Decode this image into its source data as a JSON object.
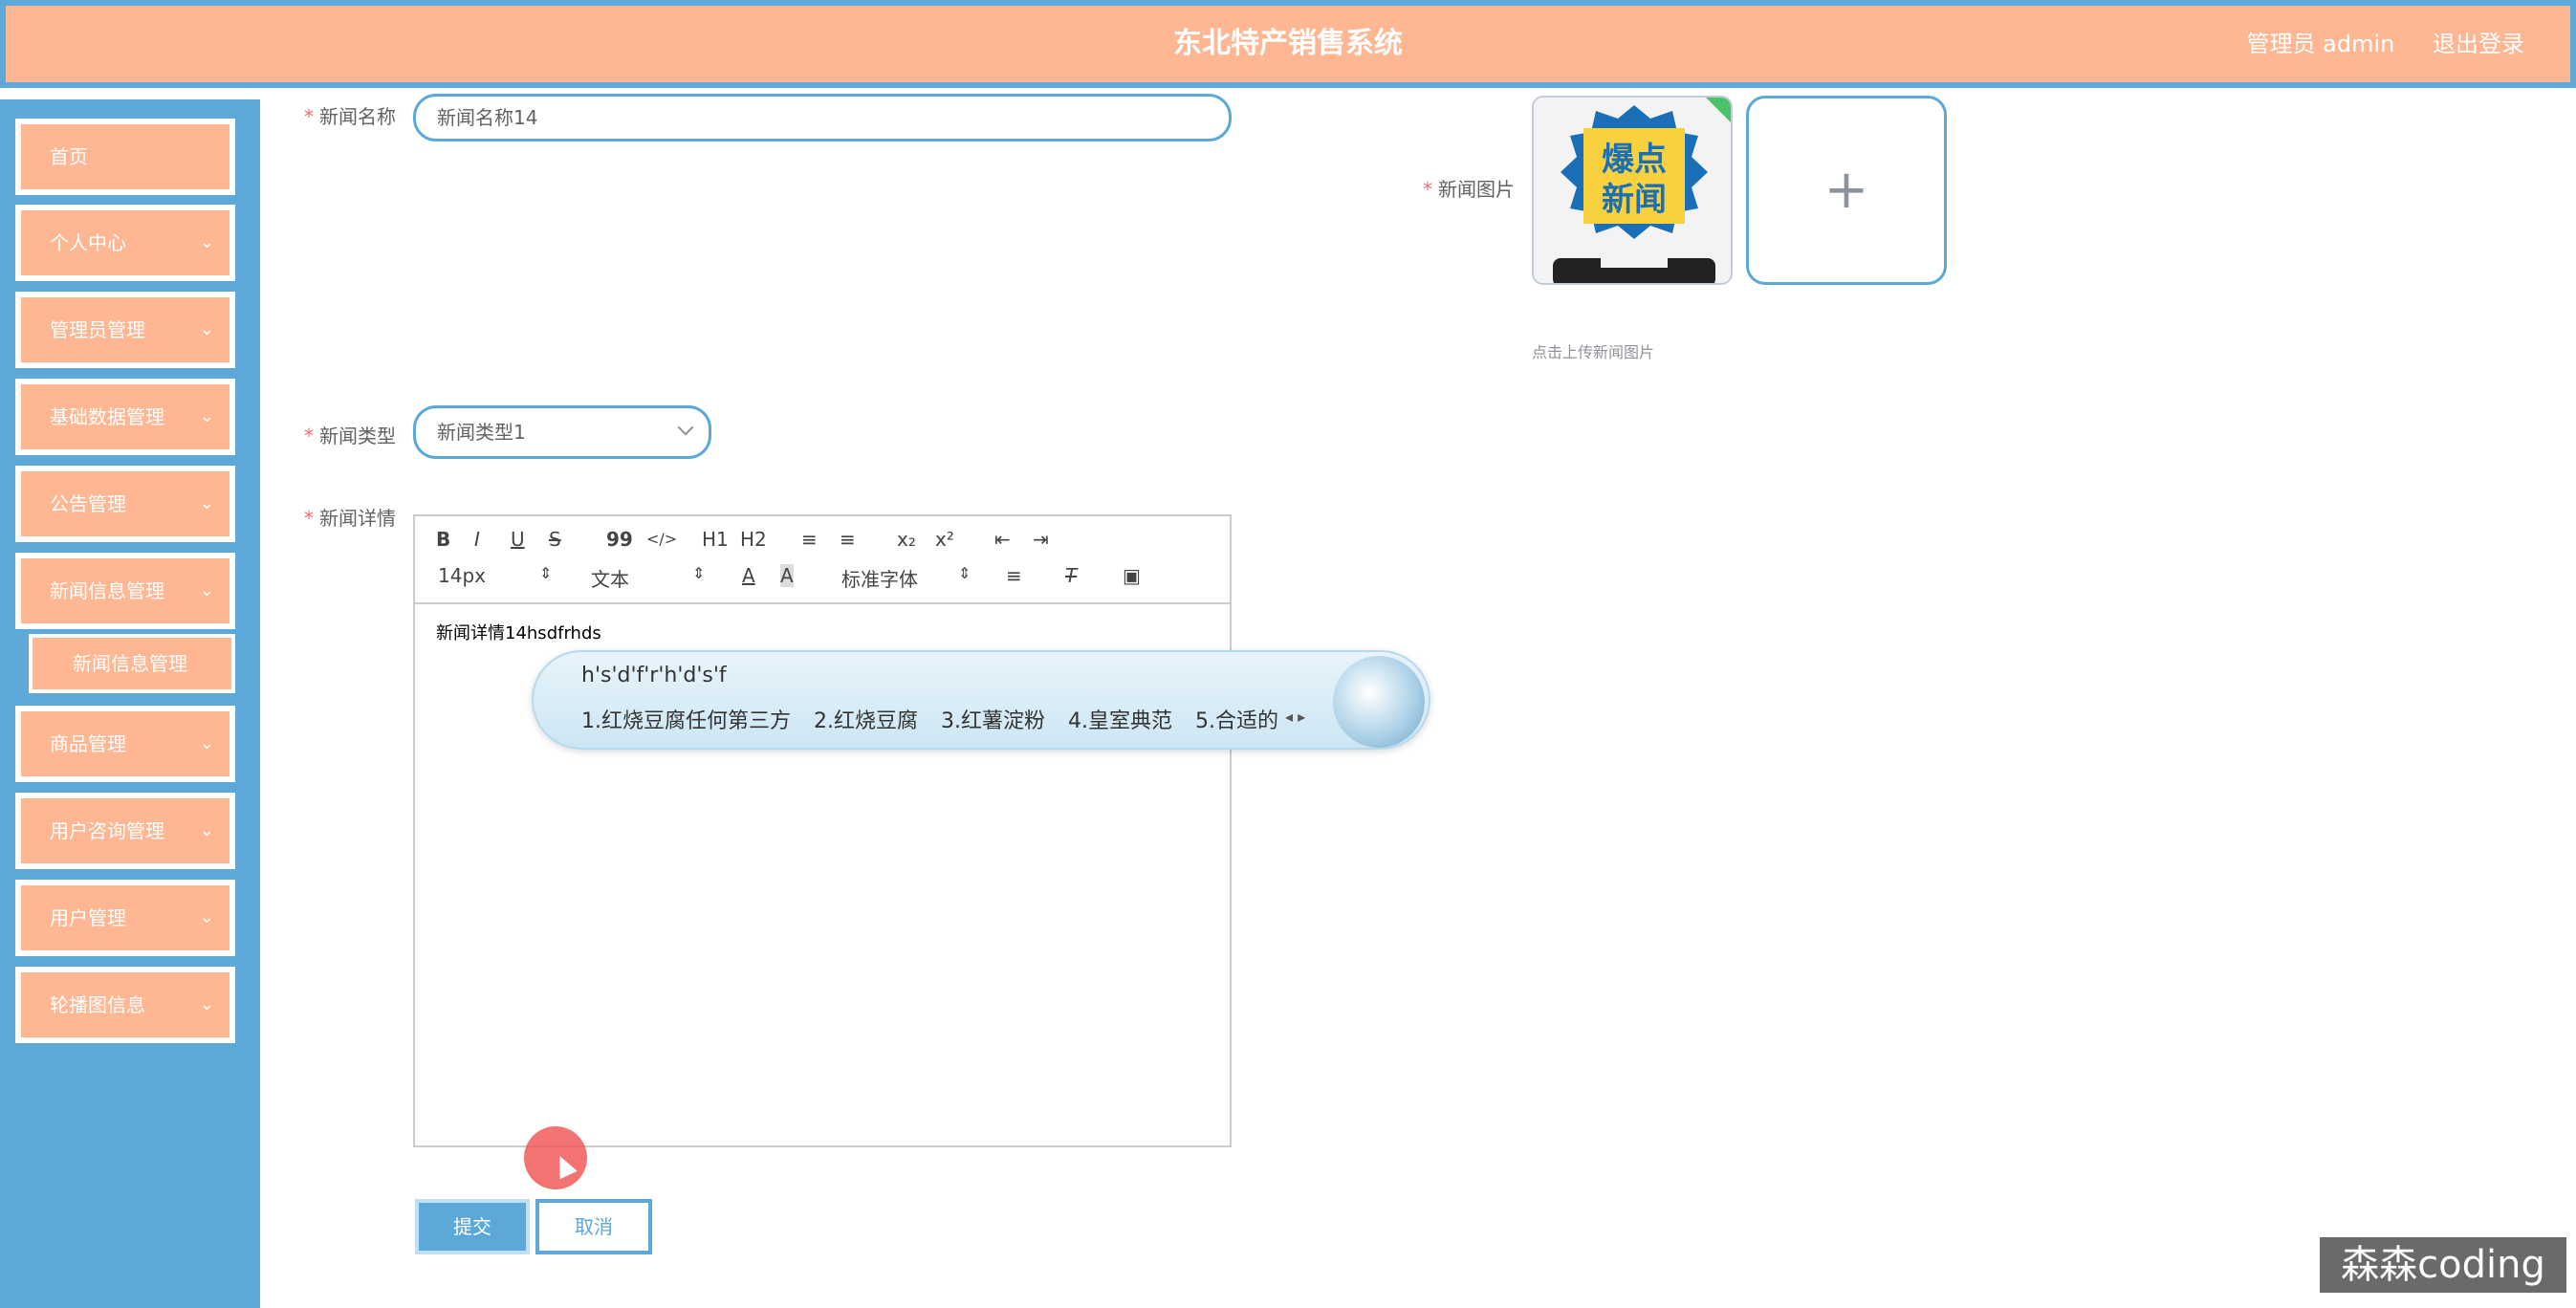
{
  "header": {
    "title": "东北特产销售系统",
    "user": "管理员 admin",
    "logout": "退出登录"
  },
  "sidebar": {
    "items": [
      {
        "label": "首页",
        "chevron": false
      },
      {
        "label": "个人中心",
        "chevron": true
      },
      {
        "label": "管理员管理",
        "chevron": true
      },
      {
        "label": "基础数据管理",
        "chevron": true
      },
      {
        "label": "公告管理",
        "chevron": true
      },
      {
        "label": "新闻信息管理",
        "chevron": true
      },
      {
        "label": "商品管理",
        "chevron": true
      },
      {
        "label": "用户咨询管理",
        "chevron": true
      },
      {
        "label": "用户管理",
        "chevron": true
      },
      {
        "label": "轮播图信息",
        "chevron": true
      }
    ],
    "sub_item": "新闻信息管理"
  },
  "form": {
    "name_label": "新闻名称",
    "name_value": "新闻名称14",
    "image_label": "新闻图片",
    "image_text_line1": "爆点",
    "image_text_line2": "新闻",
    "upload_plus": "+",
    "upload_tip": "点击上传新闻图片",
    "type_label": "新闻类型",
    "type_value": "新闻类型1",
    "detail_label": "新闻详情",
    "required_mark": "*"
  },
  "editor": {
    "toolbar": {
      "bold": "B",
      "italic": "I",
      "underline": "U",
      "strike": "S",
      "quote": "99",
      "code": "</>",
      "h1": "H1",
      "h2": "H2",
      "ol": "≡",
      "ul": "≡",
      "sub": "x₂",
      "sup": "x²",
      "outdent": "⇤",
      "indent": "⇥",
      "font_size": "14px",
      "header_select": "文本",
      "font_color": "A",
      "bg_color": "A",
      "font_family": "标准字体",
      "align": "≡",
      "clean": "T",
      "image": "▣"
    },
    "content": "新闻详情14hsdfrhds"
  },
  "ime": {
    "composition": "h's'd'f'r'h'd's'f",
    "candidates": [
      "1.红烧豆腐任何第三方",
      "2.红烧豆腐",
      "3.红薯淀粉",
      "4.皇室典范",
      "5.合适的"
    ],
    "arrows": "◂ ▸"
  },
  "buttons": {
    "submit": "提交",
    "cancel": "取消"
  },
  "watermark": "森森coding"
}
